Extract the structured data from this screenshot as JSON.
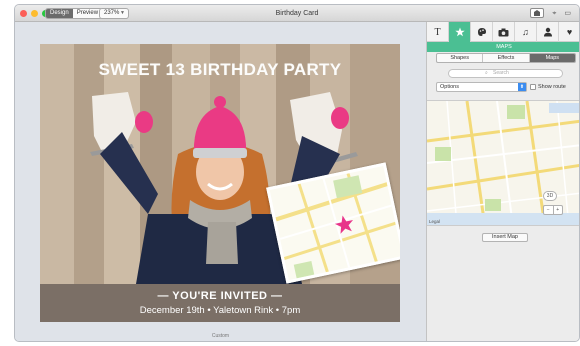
{
  "window": {
    "title": "Birthday Card"
  },
  "toolbar": {
    "mode_tabs": [
      {
        "label": "Design",
        "active": true
      },
      {
        "label": "Preview",
        "active": false
      }
    ],
    "zoom": "237%",
    "share_icon": "share-icon",
    "pin_icon": "pin-icon"
  },
  "card": {
    "headline": "SWEET 13 BIRTHDAY PARTY",
    "invited": "— YOU'RE INVITED —",
    "details": "December 19th • Yaletown Rink • 7pm",
    "footer_color": "#7b6f66"
  },
  "canvas": {
    "caption": "Custom"
  },
  "inspector": {
    "tools": [
      {
        "icon": "text-icon",
        "glyph": "T",
        "active": false
      },
      {
        "icon": "star-icon",
        "glyph": "★",
        "active": true
      },
      {
        "icon": "palette-icon",
        "glyph": "◉",
        "active": false
      },
      {
        "icon": "camera-icon",
        "glyph": "▣",
        "active": false
      },
      {
        "icon": "music-icon",
        "glyph": "♫",
        "active": false
      },
      {
        "icon": "person-icon",
        "glyph": "♟",
        "active": false
      },
      {
        "icon": "heart-icon",
        "glyph": "♥",
        "active": false
      }
    ],
    "section_title": "MAPS",
    "subtabs": [
      {
        "label": "Shapes",
        "active": false
      },
      {
        "label": "Effects",
        "active": false
      },
      {
        "label": "Maps",
        "active": true
      }
    ],
    "search_placeholder": "Search",
    "options_label": "Options",
    "show_route_label": "Show route",
    "map_3d": "3D",
    "zoom_minus": "−",
    "zoom_plus": "+",
    "legal_label": "Legal",
    "insert_label": "Insert Map",
    "accent": "#4bbf93"
  }
}
